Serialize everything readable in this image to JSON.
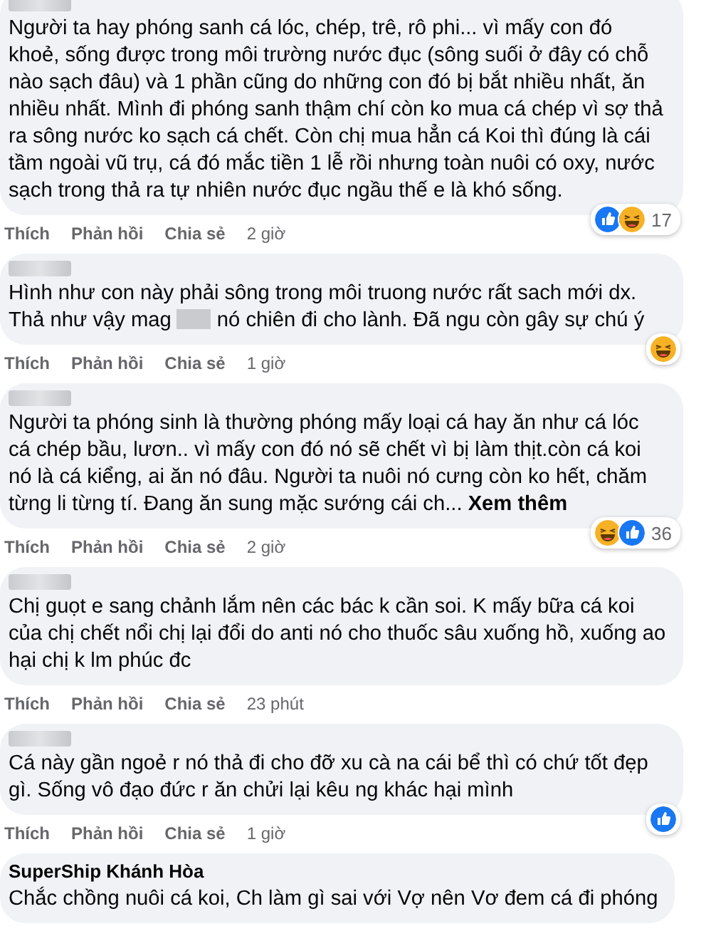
{
  "comments": [
    {
      "author": {
        "kind": "blurred"
      },
      "segments": [
        {
          "kind": "text",
          "text": "Người ta hay phóng sanh cá lóc, chép, trê, rô phi... vì mấy con đó khoẻ, sống được trong môi trường nước đục (sông suối ở đây có chỗ nào sạch đâu) và 1 phần cũng do những con đó bị bắt nhiều nhất, ăn nhiều nhất. Mình đi phóng sanh thậm chí còn ko mua cá chép vì sợ thả ra sông nước ko sạch cá chết. Còn chị mua hẳn cá Koi thì đúng là cái tầm ngoài vũ trụ, cá đó mắc tiền 1 lễ rồi nhưng toàn nuôi có oxy, nước sạch trong thả ra tự nhiên nước đục ngầu thế e là khó sống."
        }
      ],
      "reactions": [
        {
          "kind": "like"
        },
        {
          "kind": "haha"
        }
      ],
      "reaction_count": "17",
      "actions": [
        "Thích",
        "Phản hồi",
        "Chia sẻ"
      ],
      "time": "2 giờ"
    },
    {
      "author": {
        "kind": "blurred"
      },
      "segments": [
        {
          "kind": "text",
          "text": "Hình như con này phải sông trong môi truong nước rất sach mới dx. Thả như vậy mag"
        },
        {
          "kind": "redacted"
        },
        {
          "kind": "text",
          "text": "nó chiên đi cho lành. Đã ngu còn gây sự chú ý"
        }
      ],
      "reactions": [
        {
          "kind": "haha"
        }
      ],
      "actions": [
        "Thích",
        "Phản hồi",
        "Chia sẻ"
      ],
      "time": "1 giờ"
    },
    {
      "author": {
        "kind": "blurred"
      },
      "segments": [
        {
          "kind": "text",
          "text": "Người ta phóng sinh là thường phóng mấy loại cá hay ăn như cá lóc cá chép bầu, lươn.. vì mấy con đó nó sẽ chết vì bị làm thịt.còn cá koi nó là cá kiểng, ai ăn nó đâu. Người ta nuôi nó cưng còn ko hết, chăm từng li từng tí. Đang ăn sung mặc sướng cái ch..."
        },
        {
          "kind": "link",
          "text": "Xem thêm"
        }
      ],
      "reactions": [
        {
          "kind": "haha"
        },
        {
          "kind": "like"
        }
      ],
      "reaction_count": "36",
      "actions": [
        "Thích",
        "Phản hồi",
        "Chia sẻ"
      ],
      "time": "2 giờ"
    },
    {
      "author": {
        "kind": "blurred"
      },
      "segments": [
        {
          "kind": "text",
          "text": "Chị guọt e sang chảnh lắm nên các bác k cần soi. K mấy bữa cá koi của chị chết nổi chị lại đổi do anti nó cho thuốc sâu xuống hồ, xuống ao hại chị k lm phúc đc"
        }
      ],
      "actions": [
        "Thích",
        "Phản hồi",
        "Chia sẻ"
      ],
      "time": "23 phút"
    },
    {
      "author": {
        "kind": "blurred"
      },
      "segments": [
        {
          "kind": "text",
          "text": "Cá này gần ngoẻ r nó thả đi cho đỡ xu cà na cái bể thì có chứ tốt đẹp gì. Sống vô đạo đức r ăn chửi lại kêu ng khác hại mình"
        }
      ],
      "reactions": [
        {
          "kind": "like"
        }
      ],
      "actions": [
        "Thích",
        "Phản hồi",
        "Chia sẻ"
      ],
      "time": "1 giờ"
    },
    {
      "author": {
        "kind": "name",
        "name": "SuperShip Khánh Hòa"
      },
      "segments": [
        {
          "kind": "text",
          "text": "Chắc chồng nuôi cá koi, Ch làm gì sai với Vợ nên Vơ đem cá đi phóng"
        }
      ]
    }
  ]
}
